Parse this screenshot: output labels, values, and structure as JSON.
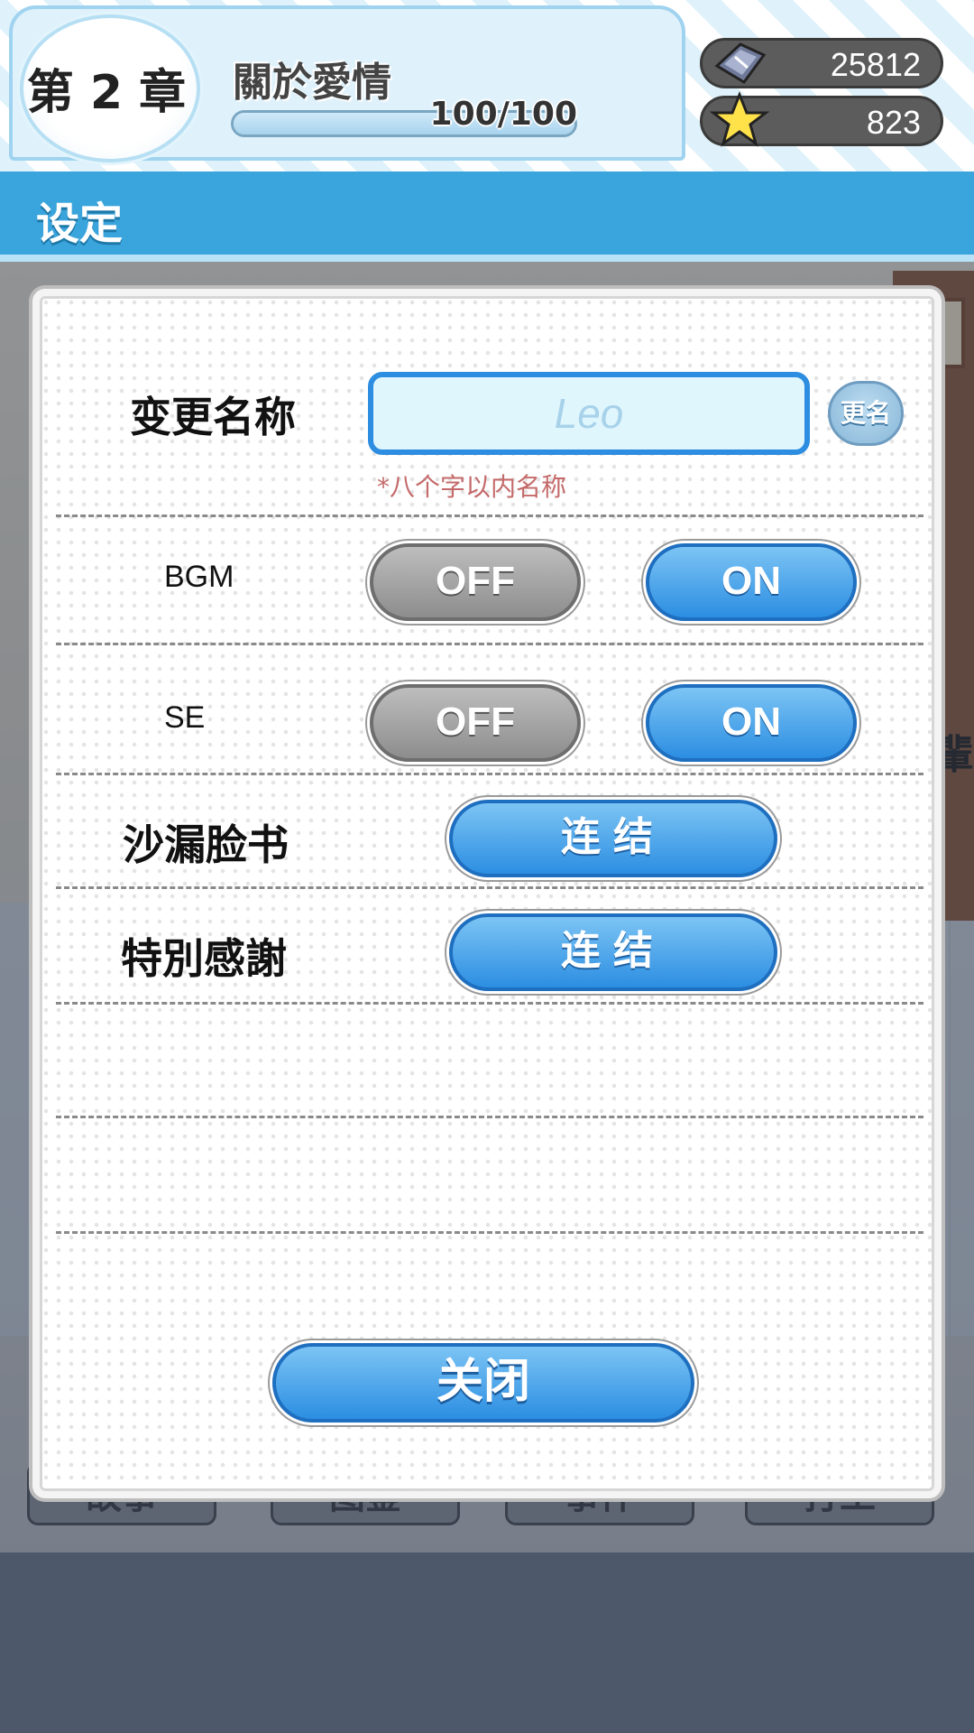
{
  "header": {
    "chapter_label": "第 2 章",
    "chapter_title": "關於愛情",
    "progress_text": "100/100",
    "progress_fraction": 1.0,
    "currency": [
      {
        "icon": "gem-icon",
        "value": "25812"
      },
      {
        "icon": "star-icon",
        "value": "823"
      }
    ]
  },
  "title_bar": {
    "title": "设定"
  },
  "settings": {
    "rename": {
      "label": "变更名称",
      "placeholder": "Leo",
      "button_label": "更名",
      "hint": "*八个字以内名称"
    },
    "bgm": {
      "label": "BGM",
      "off_label": "OFF",
      "on_label": "ON",
      "selected": "ON"
    },
    "se": {
      "label": "SE",
      "off_label": "OFF",
      "on_label": "ON",
      "selected": "ON"
    },
    "facebook": {
      "label": "沙漏脸书",
      "button_label": "连结"
    },
    "thanks": {
      "label": "特別感謝",
      "button_label": "连结"
    },
    "close_label": "关闭"
  },
  "background": {
    "nav_buttons": [
      "故事",
      "图鉴",
      "事件",
      "打工"
    ],
    "partial_char": "輩"
  },
  "colors": {
    "accent": "#3aa4dc",
    "button_blue": "#2c8ee2",
    "button_gray": "#8d8d8d",
    "hint_red": "#c56a6a"
  }
}
